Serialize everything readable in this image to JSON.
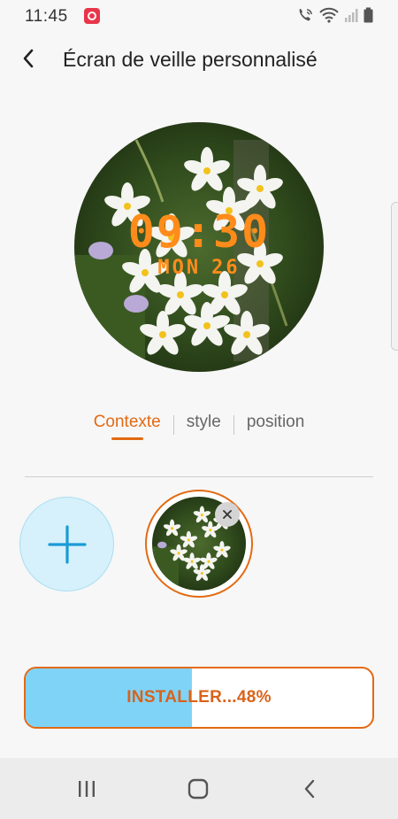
{
  "status_bar": {
    "time": "11:45",
    "icons": [
      "app-notification-icon",
      "wifi-calling-icon",
      "wifi-icon",
      "signal-icon",
      "battery-icon"
    ]
  },
  "header": {
    "back_icon": "chevron-left-icon",
    "title": "Écran de veille personnalisé"
  },
  "preview": {
    "time": "09:30",
    "day": "MON",
    "date": "26",
    "clock_color": "#ff8c1a"
  },
  "tabs": [
    {
      "label": "Contexte",
      "active": true
    },
    {
      "label": "style",
      "active": false
    },
    {
      "label": "position",
      "active": false
    }
  ],
  "gallery": {
    "add_icon": "plus-icon",
    "remove_icon": "close-icon"
  },
  "install": {
    "label": "INSTALLER...48%",
    "progress_percent": 48
  },
  "nav": {
    "icons": [
      "recent-apps-icon",
      "home-icon",
      "back-icon"
    ]
  },
  "colors": {
    "accent": "#e36a12",
    "progress_fill": "#7fd3f7",
    "add_button_bg": "#d6f1fb"
  }
}
